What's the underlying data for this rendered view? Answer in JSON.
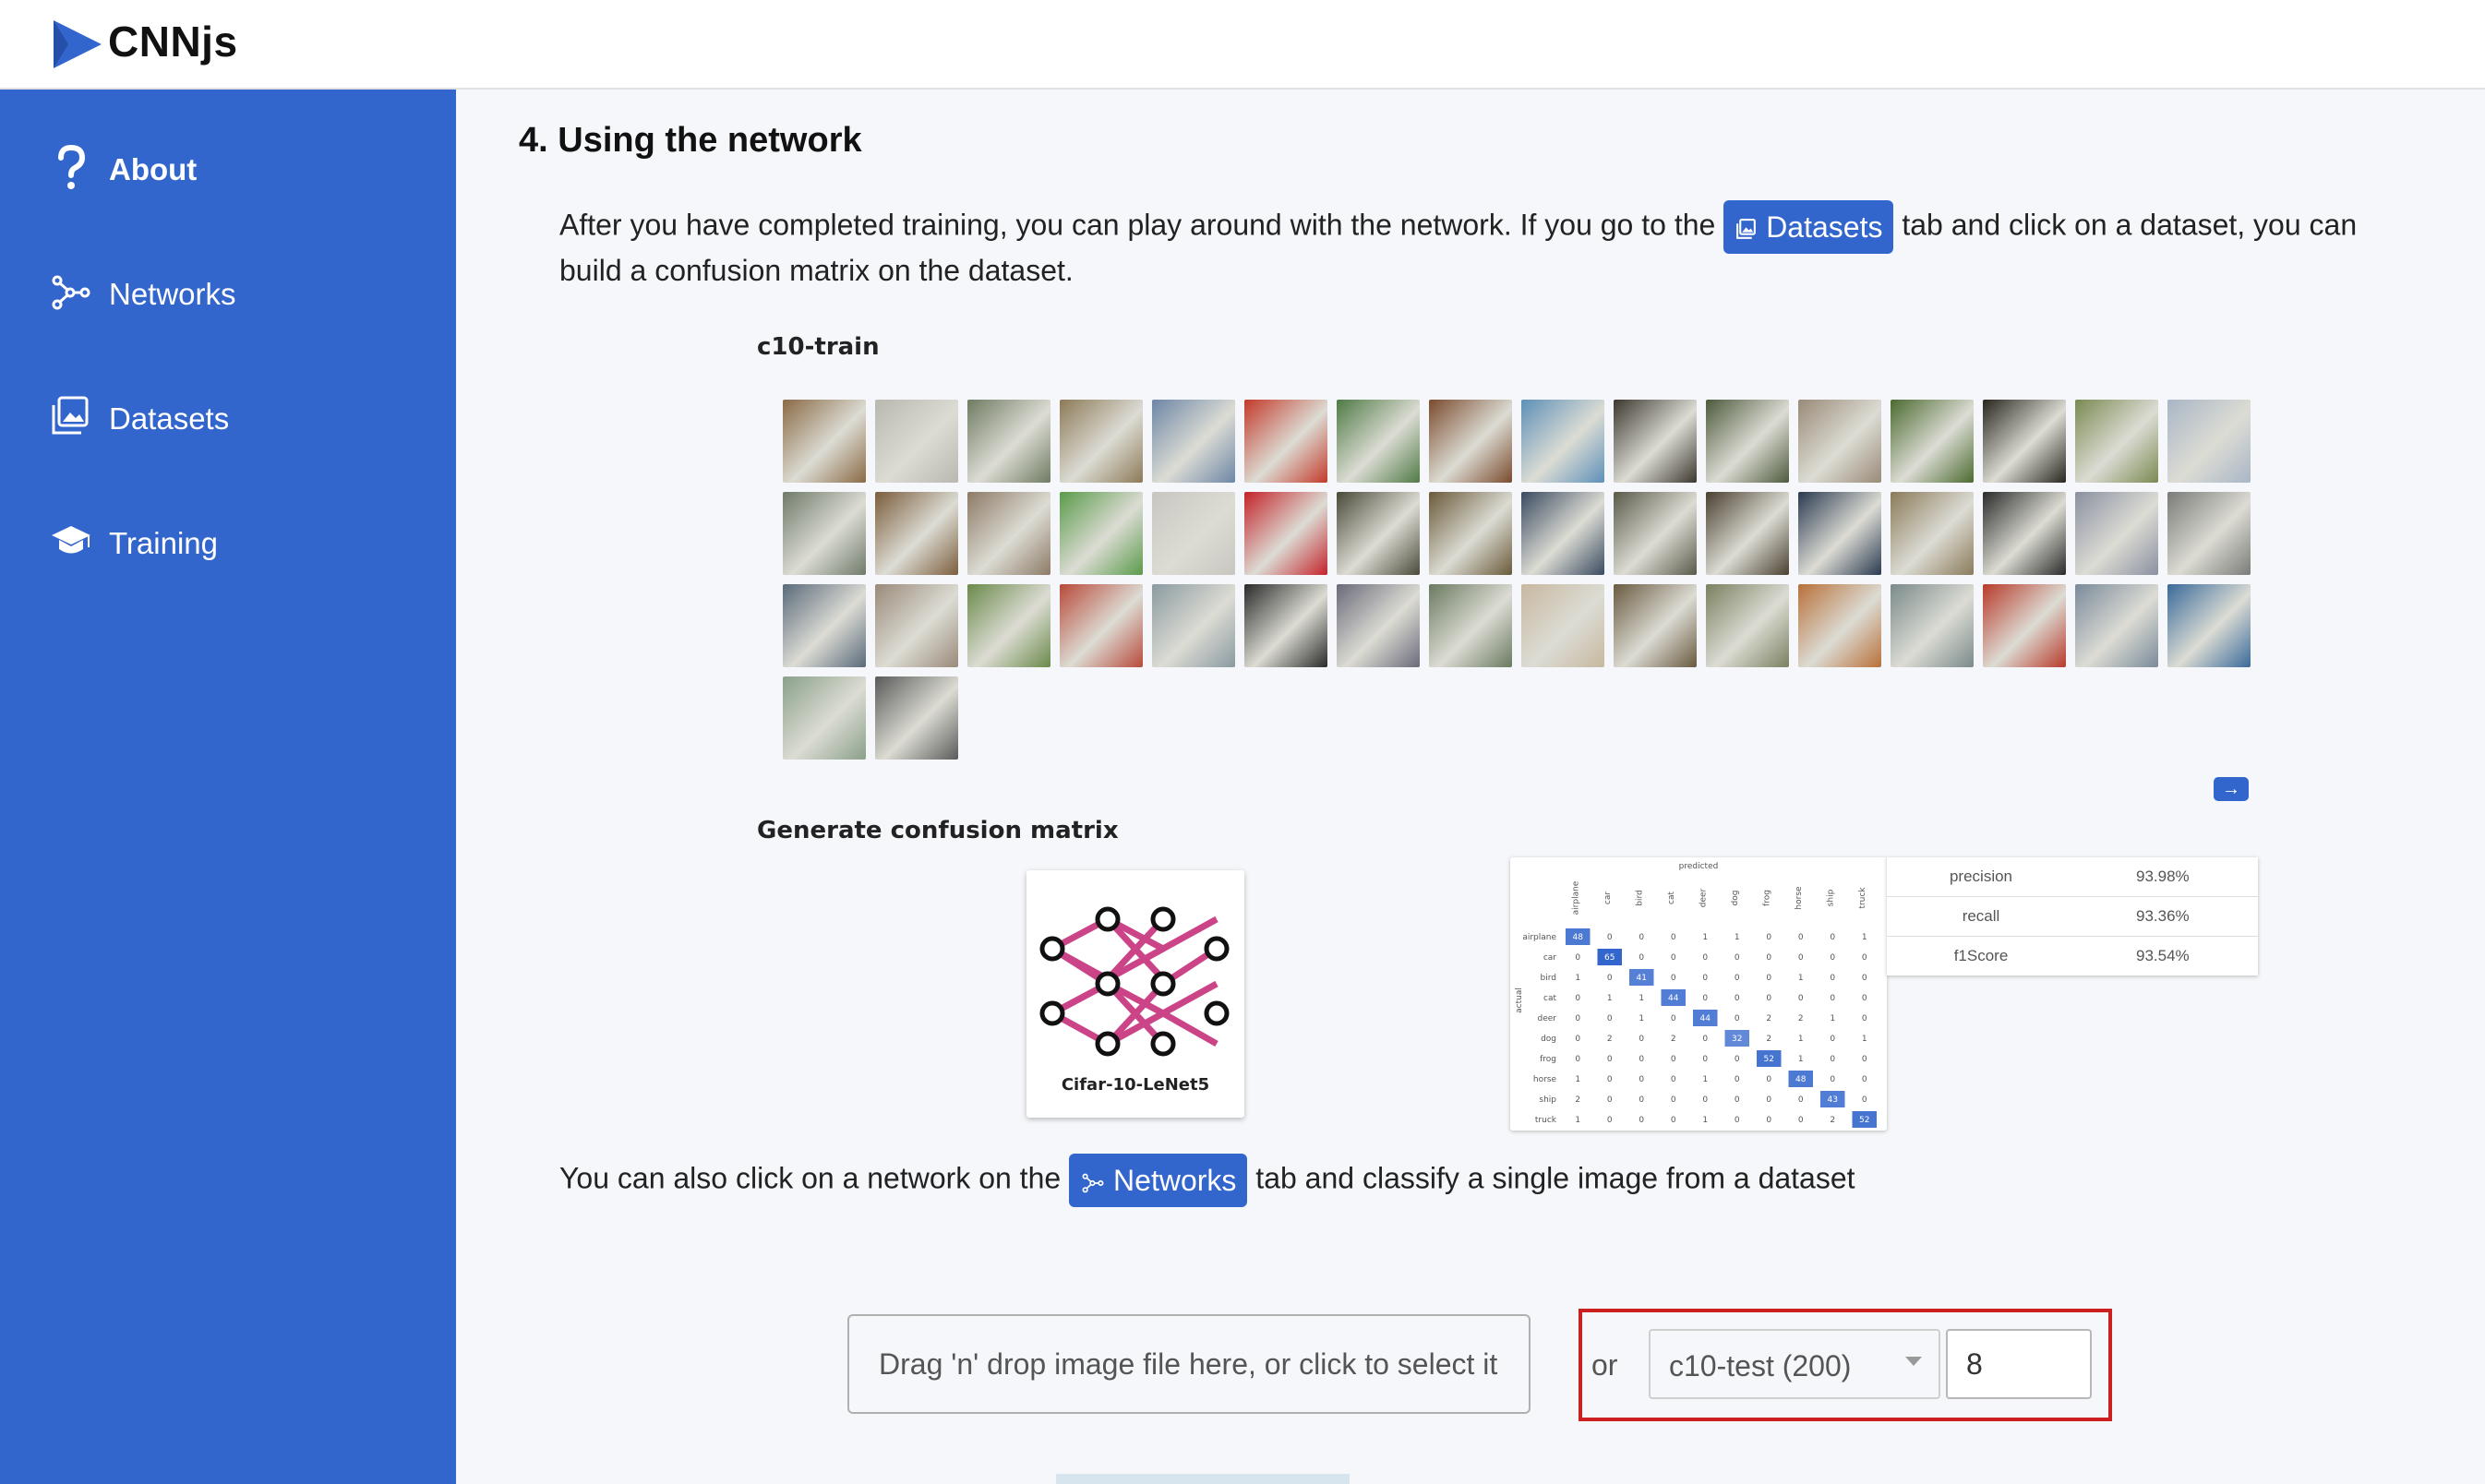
{
  "app": {
    "name": "CNNjs"
  },
  "sidebar": {
    "items": [
      {
        "label": "About",
        "icon": "question-icon",
        "active": true
      },
      {
        "label": "Networks",
        "icon": "network-icon",
        "active": false
      },
      {
        "label": "Datasets",
        "icon": "images-icon",
        "active": false
      },
      {
        "label": "Training",
        "icon": "graduation-cap-icon",
        "active": false
      }
    ]
  },
  "main": {
    "heading": "4. Using the network",
    "para1_before": "After you have completed training, you can play around with the network. If you go to the",
    "para1_chip": "Datasets",
    "para1_after_line1": "tab and click on a dataset, you can",
    "para1_line2": "build a confusion matrix on the dataset.",
    "dataset_title": "c10-train",
    "confusion_title": "Generate confusion matrix",
    "network_name": "Cifar-10-LeNet5",
    "para2_before": "You can also click on a network on the",
    "para2_chip": "Networks",
    "para2_after": "tab and classify a single image from a dataset",
    "dropzone_text": "Drag 'n' drop image file here, or click to select it",
    "or_label": "or",
    "dataset_select": "c10-test (200)",
    "image_index": "8"
  },
  "confusion_matrix": {
    "predicted_label": "predicted",
    "actual_label": "actual",
    "classes": [
      "airplane",
      "car",
      "bird",
      "cat",
      "deer",
      "dog",
      "frog",
      "horse",
      "ship",
      "truck"
    ],
    "rows": [
      [
        48,
        0,
        0,
        0,
        1,
        1,
        0,
        0,
        0,
        1
      ],
      [
        0,
        65,
        0,
        0,
        0,
        0,
        0,
        0,
        0,
        0
      ],
      [
        1,
        0,
        41,
        0,
        0,
        0,
        0,
        1,
        0,
        0
      ],
      [
        0,
        1,
        1,
        44,
        0,
        0,
        0,
        0,
        0,
        0
      ],
      [
        0,
        0,
        1,
        0,
        44,
        0,
        2,
        2,
        1,
        0
      ],
      [
        0,
        2,
        0,
        2,
        0,
        32,
        2,
        1,
        0,
        1
      ],
      [
        0,
        0,
        0,
        0,
        0,
        0,
        52,
        1,
        0,
        0
      ],
      [
        1,
        0,
        0,
        0,
        1,
        0,
        0,
        48,
        0,
        0
      ],
      [
        2,
        0,
        0,
        0,
        0,
        0,
        0,
        0,
        43,
        0
      ],
      [
        1,
        0,
        0,
        0,
        1,
        0,
        0,
        0,
        2,
        52
      ]
    ]
  },
  "metrics": [
    {
      "name": "precision",
      "value": "93.98%"
    },
    {
      "name": "recall",
      "value": "93.36%"
    },
    {
      "name": "f1Score",
      "value": "93.54%"
    }
  ],
  "colors": {
    "accent": "#3366cc",
    "highlight": "#cc2020",
    "network_edges": "#cc4488"
  }
}
